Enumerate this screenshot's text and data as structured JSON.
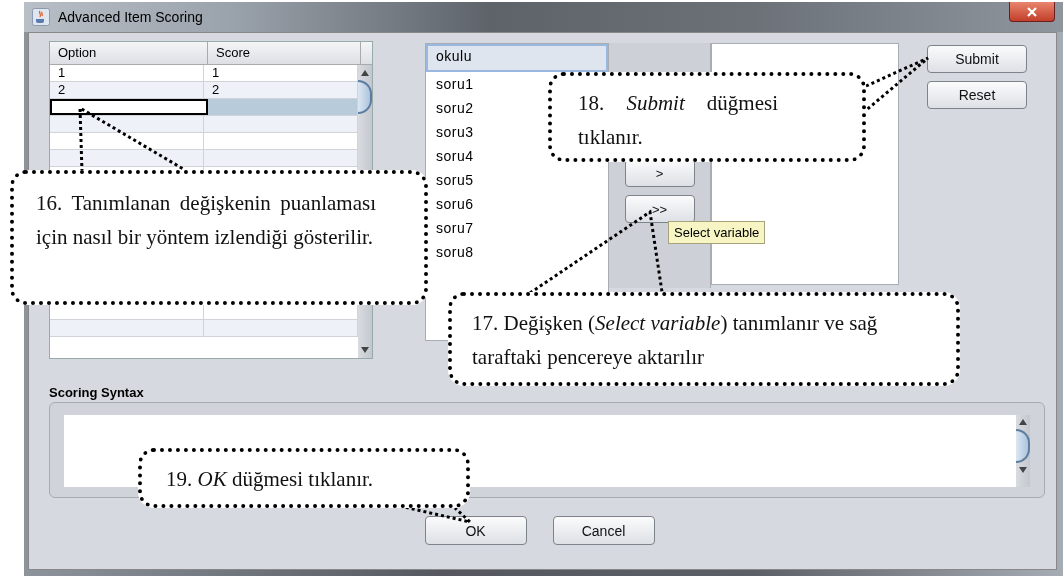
{
  "window": {
    "title": "Advanced Item Scoring"
  },
  "table": {
    "columns": [
      "Option",
      "Score"
    ],
    "rows": [
      {
        "cells": [
          "1",
          "1"
        ],
        "selected": false
      },
      {
        "cells": [
          "2",
          "2"
        ],
        "selected": false
      }
    ],
    "new_row": {
      "selected": true
    }
  },
  "variables": [
    {
      "label": "okulu",
      "selected": true
    },
    {
      "label": "soru1",
      "selected": false
    },
    {
      "label": "soru2",
      "selected": false
    },
    {
      "label": "soru3",
      "selected": false
    },
    {
      "label": "soru4",
      "selected": false
    },
    {
      "label": "soru5",
      "selected": false
    },
    {
      "label": "soru6",
      "selected": false
    },
    {
      "label": "soru7",
      "selected": false
    },
    {
      "label": "soru8",
      "selected": false
    }
  ],
  "move_buttons": [
    ">",
    ">>"
  ],
  "tooltip": "Select variable",
  "side_buttons": [
    "Submit",
    "Reset"
  ],
  "syntax": {
    "label": "Scoring Syntax"
  },
  "buttons": [
    "OK",
    "Cancel"
  ],
  "callouts": [
    {
      "text": "16. Tanımlanan değişkenin puanlaması için nasıl bir yöntem izlendiği gösterilir."
    },
    {
      "text": "18. *Submit* düğmesi tıklanır."
    },
    {
      "text": "17. Değişken (*Select variable*) tanımlanır ve sağ taraftaki pencereye aktarılır"
    },
    {
      "text": "19. *OK* düğmesi tıklanır."
    }
  ]
}
